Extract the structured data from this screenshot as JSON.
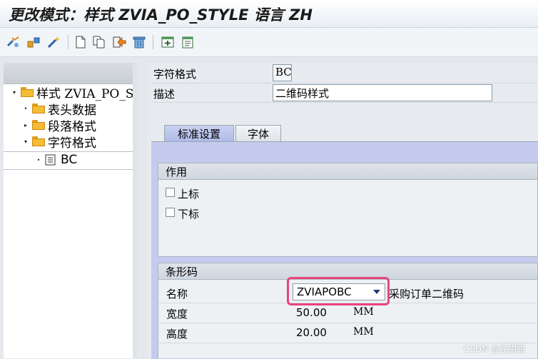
{
  "window": {
    "title": "更改模式：样式 ZVIA_PO_STYLE 语言 ZH"
  },
  "toolbar": {
    "icons": [
      "display-change-icon",
      "other-object-icon",
      "magic-wand-icon",
      "new-document-icon",
      "copy-icon",
      "transport-icon",
      "delete-icon",
      "add-window-icon",
      "document-window-icon"
    ]
  },
  "tree": {
    "root": {
      "label": "样式 ZVIA_PO_S"
    },
    "items": [
      {
        "label": "表头数据",
        "expander": "•"
      },
      {
        "label": "段落格式",
        "expander": "▸"
      },
      {
        "label": "字符格式",
        "expander": "▾"
      }
    ],
    "selected": {
      "label": "BC",
      "bullet": "•"
    }
  },
  "form": {
    "char_format_label": "字符格式",
    "char_format_value": "BC",
    "desc_label": "描述",
    "desc_value": "二维码样式"
  },
  "tabs": [
    {
      "label": "标准设置",
      "active": true
    },
    {
      "label": "字体",
      "active": false
    }
  ],
  "effect_group": {
    "title": "作用",
    "superscript_label": "上标",
    "subscript_label": "下标"
  },
  "barcode_group": {
    "title": "条形码",
    "name_label": "名称",
    "name_value": "ZVIAPOBC",
    "name_desc": "采购订单二维码",
    "width_label": "宽度",
    "width_value": "50.00",
    "width_unit": "MM",
    "height_label": "高度",
    "height_value": "20.00",
    "height_unit": "MM"
  },
  "watermark": "CSDN @左甜甜",
  "colors": {
    "tab_active": "#b7c1ec",
    "highlight_border": "#e8457a",
    "folder": "#f5bc35"
  }
}
